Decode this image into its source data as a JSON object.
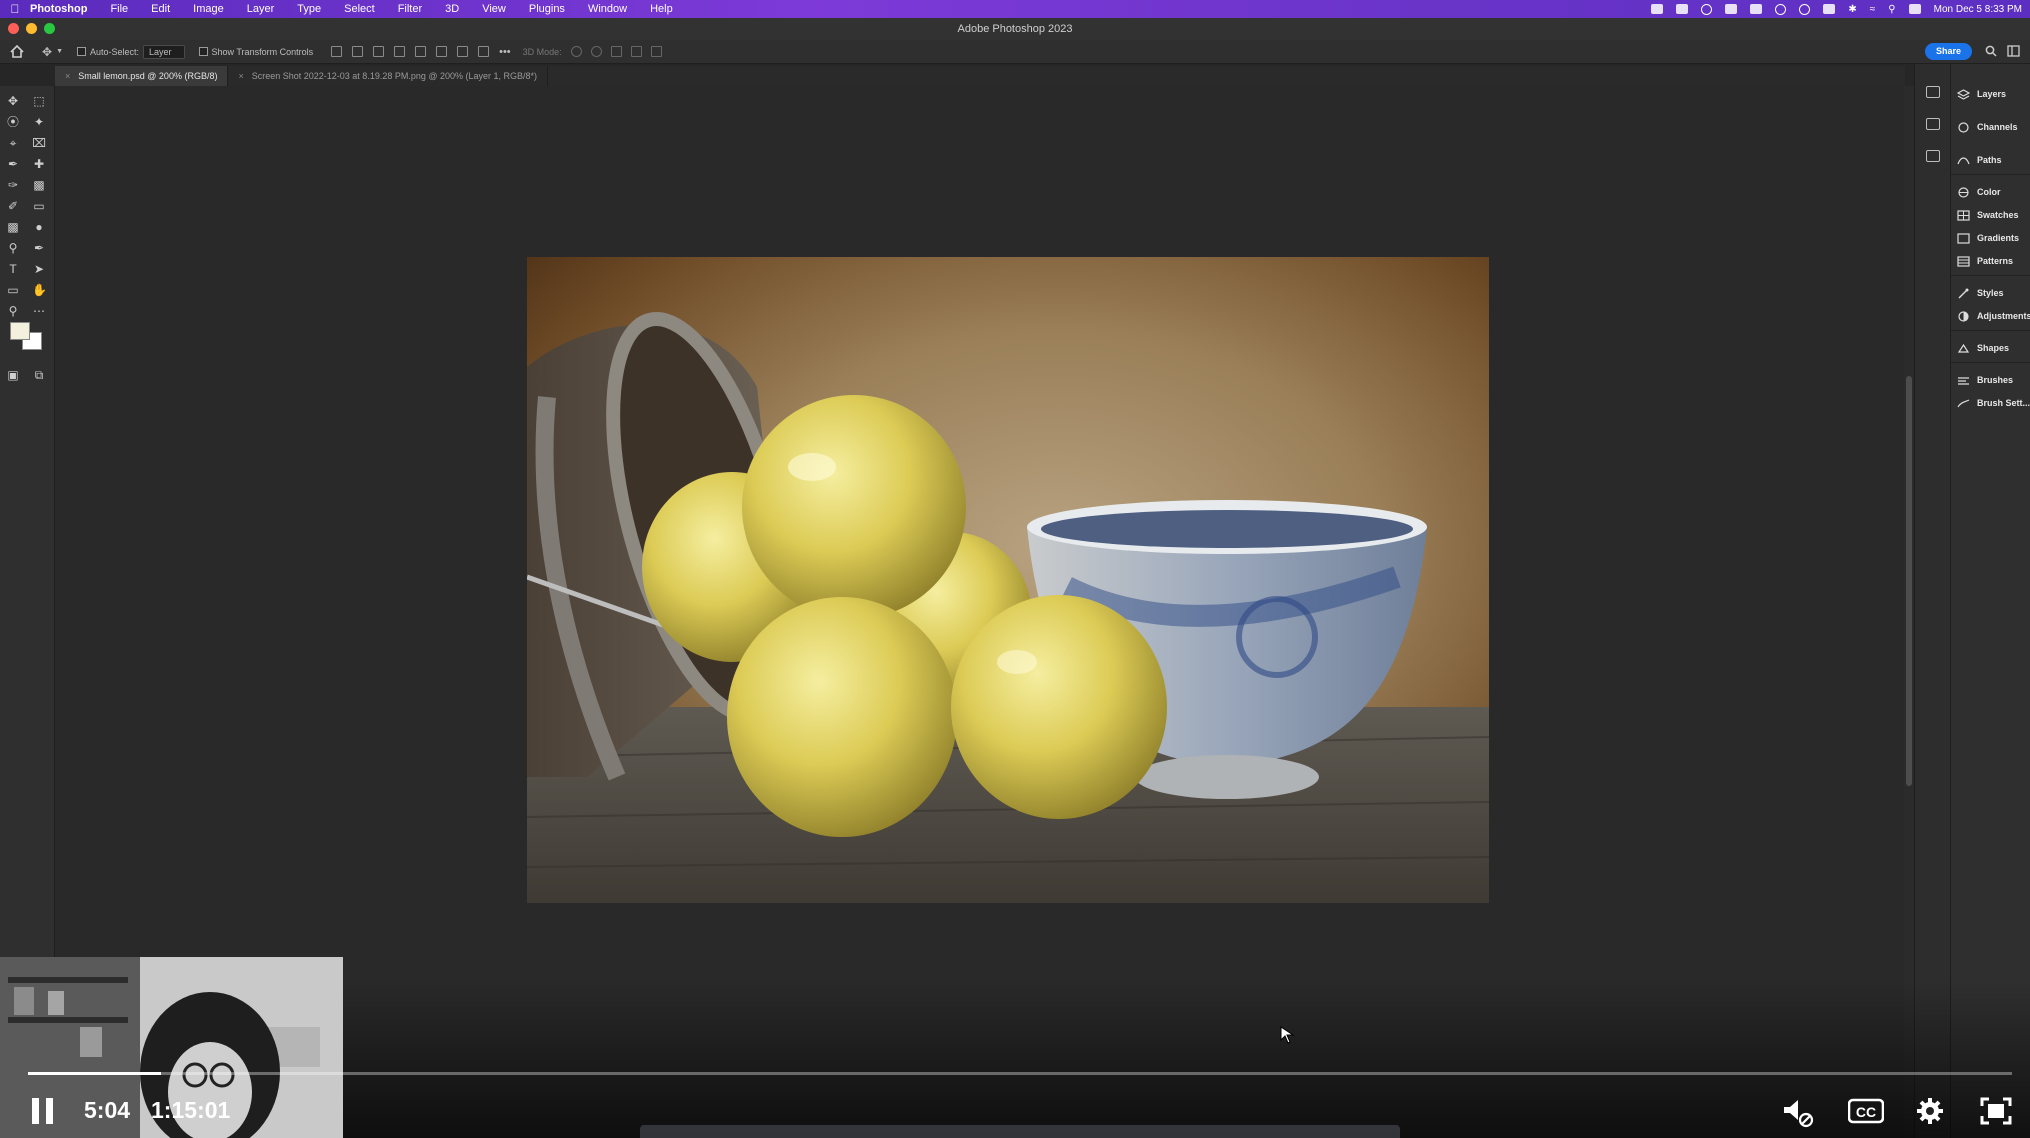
{
  "menubar": {
    "app_name": "Photoshop",
    "items": [
      "File",
      "Edit",
      "Image",
      "Layer",
      "Type",
      "Select",
      "Filter",
      "3D",
      "View",
      "Plugins",
      "Window",
      "Help"
    ],
    "clock": "Mon Dec 5  8:33 PM"
  },
  "window": {
    "title": "Adobe Photoshop 2023"
  },
  "options_bar": {
    "auto_select_label": "Auto-Select:",
    "auto_select_value": "Layer",
    "transform_label": "Show Transform Controls",
    "mode_3d_label": "3D Mode:",
    "share_label": "Share"
  },
  "tabs": [
    {
      "label": "Small lemon.psd @ 200% (RGB/8)",
      "active": true
    },
    {
      "label": "Screen Shot 2022-12-03 at 8.19.28 PM.png @ 200% (Layer 1, RGB/8*)",
      "active": false
    }
  ],
  "panels": [
    {
      "label": "Layers",
      "icon": "layers-icon"
    },
    {
      "label": "Channels",
      "icon": "channels-icon"
    },
    {
      "label": "Paths",
      "icon": "paths-icon"
    },
    {
      "label": "Color",
      "icon": "color-icon"
    },
    {
      "label": "Swatches",
      "icon": "swatches-icon"
    },
    {
      "label": "Gradients",
      "icon": "gradients-icon"
    },
    {
      "label": "Patterns",
      "icon": "patterns-icon"
    },
    {
      "label": "Styles",
      "icon": "styles-icon"
    },
    {
      "label": "Adjustments",
      "icon": "adjustments-icon"
    },
    {
      "label": "Shapes",
      "icon": "shapes-icon"
    },
    {
      "label": "Brushes",
      "icon": "brushes-icon"
    },
    {
      "label": "Brush Sett...",
      "icon": "brush-settings-icon"
    }
  ],
  "colors": {
    "foreground": "#f3f0dd",
    "background": "#ffffff",
    "accent": "#1a73e8"
  },
  "video": {
    "current_time": "5:04",
    "duration": "1:15:01",
    "progress_fraction": 0.067,
    "state": "playing"
  }
}
